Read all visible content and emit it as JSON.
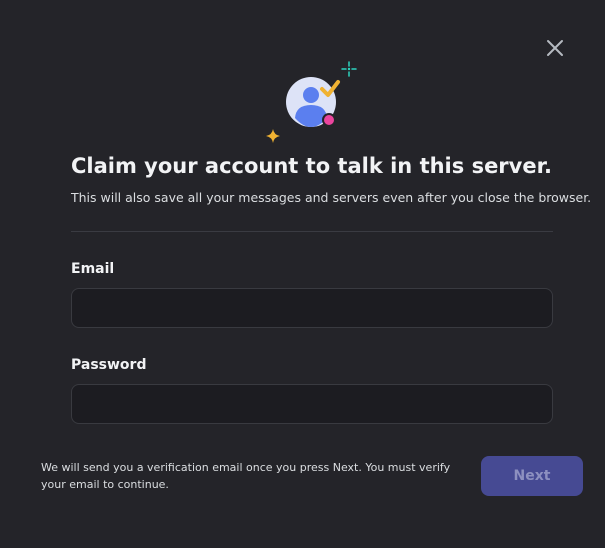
{
  "dialog": {
    "close_icon": "close-icon",
    "hero_icon": "user-avatar-check-icon",
    "title": "Claim your account to talk in this server.",
    "subtitle": "This will also save all your messages and servers even after you close the browser."
  },
  "form": {
    "email": {
      "label": "Email",
      "value": "",
      "placeholder": ""
    },
    "password": {
      "label": "Password",
      "value": "",
      "placeholder": ""
    }
  },
  "footer": {
    "note": "We will send you a verification email once you press Next. You must verify your email to continue.",
    "next_label": "Next",
    "next_disabled": true
  },
  "colors": {
    "background": "#242429",
    "accent": "#5865f2",
    "button_disabled_bg": "#464a93",
    "sparkle_yellow": "#f0b232",
    "sparkle_teal": "#2dd4bf",
    "badge_pink": "#eb459e"
  }
}
